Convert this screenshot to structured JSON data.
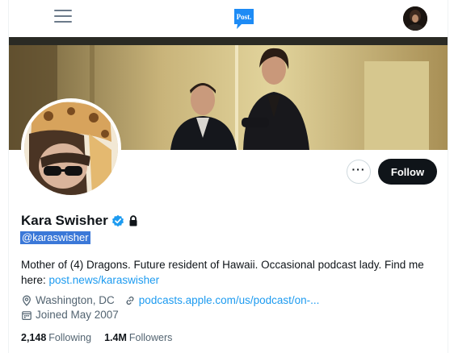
{
  "header": {
    "logo_text": "Post.",
    "menu_icon": "hamburger-icon"
  },
  "profile": {
    "name": "Kara Swisher",
    "handle": "@karaswisher",
    "bio_text": "Mother of (4) Dragons. Future resident of Hawaii. Occasional podcast lady. Find me here: ",
    "bio_link": "post.news/karaswisher",
    "location": "Washington, DC",
    "website": "podcasts.apple.com/us/podcast/on-...",
    "joined": "Joined May 2007",
    "following_count": "2,148",
    "following_label": "Following",
    "followers_count": "1.4M",
    "followers_label": "Followers"
  },
  "actions": {
    "more_label": "···",
    "follow_label": "Follow"
  },
  "colors": {
    "accent": "#1d9bf0",
    "follow_bg": "#0f1419"
  }
}
